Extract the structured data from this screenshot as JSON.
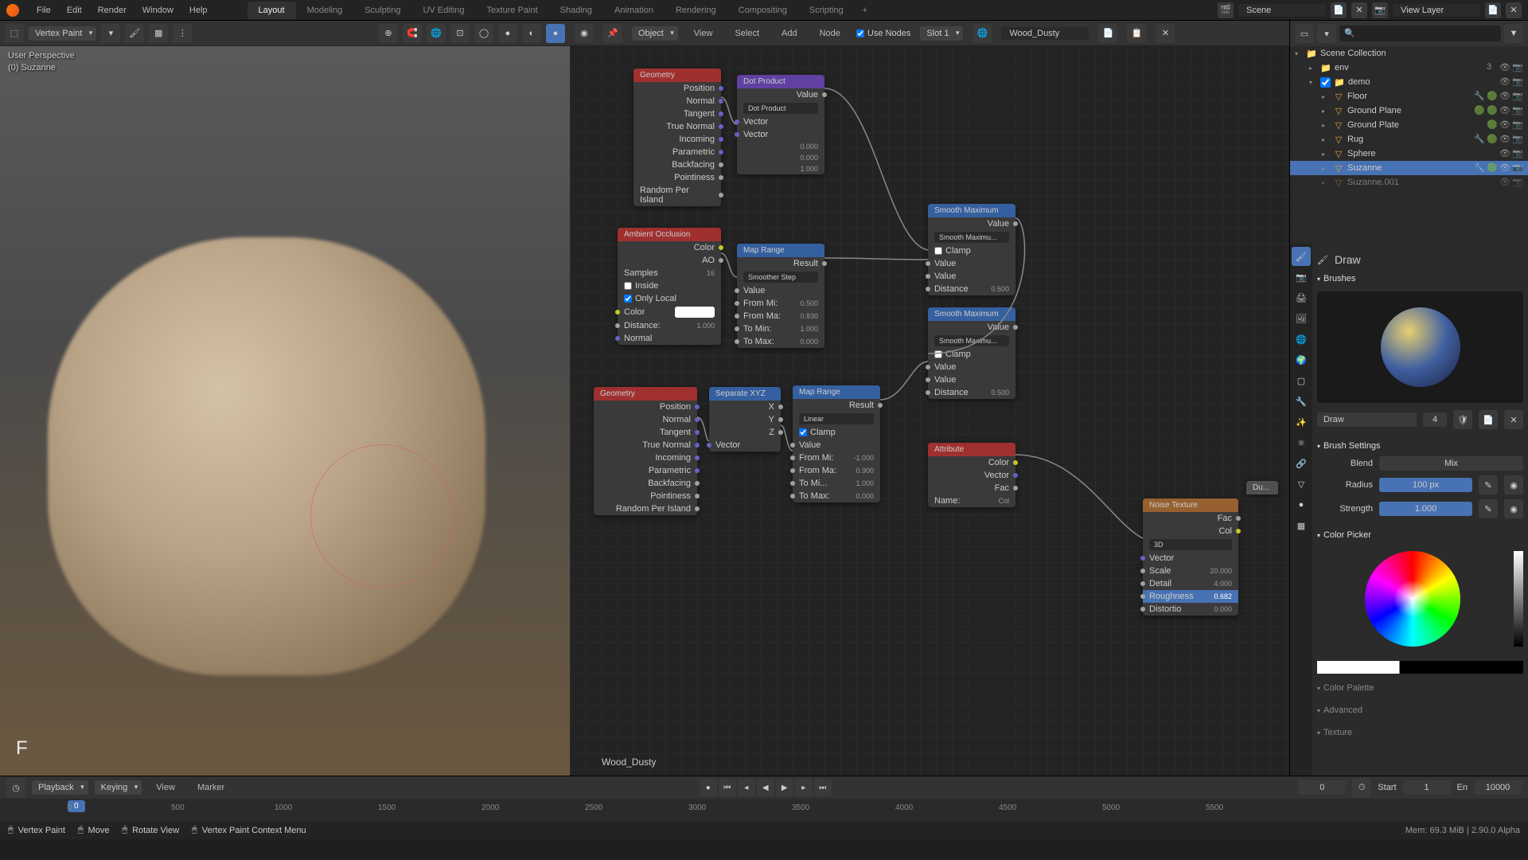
{
  "menu": {
    "file": "File",
    "edit": "Edit",
    "render": "Render",
    "window": "Window",
    "help": "Help"
  },
  "topRight": {
    "scene": "Scene",
    "viewLayer": "View Layer"
  },
  "workspaces": {
    "layout": "Layout",
    "modeling": "Modeling",
    "sculpting": "Sculpting",
    "uv": "UV Editing",
    "texpaint": "Texture Paint",
    "shading": "Shading",
    "animation": "Animation",
    "rendering": "Rendering",
    "compositing": "Compositing",
    "scripting": "Scripting",
    "add": "+"
  },
  "viewport": {
    "mode": "Vertex Paint",
    "perspective": "User Perspective",
    "object": "(0) Suzanne",
    "f": "F"
  },
  "nodeHeader": {
    "object": "Object",
    "view": "View",
    "select": "Select",
    "add": "Add",
    "node": "Node",
    "useNodes": "Use Nodes",
    "slot": "Slot 1",
    "material": "Wood_Dusty"
  },
  "nodes": {
    "geometry1": {
      "title": "Geometry",
      "position": "Position",
      "normal": "Normal",
      "tangent": "Tangent",
      "trueNormal": "True Normal",
      "incoming": "Incoming",
      "parametric": "Parametric",
      "backfacing": "Backfacing",
      "pointiness": "Pointiness",
      "randomPerIsland": "Random Per Island",
      "v1": "0.000",
      "v2": "0.000",
      "v3": "1.000"
    },
    "dotProduct": {
      "title": "Dot Product",
      "value": "Value",
      "mode": "Dot Product",
      "vector": "Vector",
      "vector2": "Vector"
    },
    "ao": {
      "title": "Ambient Occlusion",
      "color": "Color",
      "ao": "AO",
      "samples": "Samples",
      "samplesVal": "16",
      "inside": "Inside",
      "onlyLocal": "Only Local",
      "colorLabel": "Color",
      "distance": "Distance:",
      "distanceVal": "1.000",
      "normal": "Normal"
    },
    "mapRange1": {
      "title": "Map Range",
      "result": "Result",
      "interp": "Smoother Step",
      "value": "Value",
      "fromMin": "From Mi:",
      "fromMinVal": "0.500",
      "fromMax": "From Ma:",
      "fromMaxVal": "0.830",
      "toMin": "To Min:",
      "toMinVal": "1.000",
      "toMax": "To Max:",
      "toMaxVal": "0.000"
    },
    "geometry2": {
      "title": "Geometry",
      "position": "Position",
      "normal": "Normal",
      "tangent": "Tangent",
      "trueNormal": "True Normal",
      "incoming": "Incoming",
      "parametric": "Parametric",
      "backfacing": "Backfacing",
      "pointiness": "Pointiness",
      "randomPerIsland": "Random Per Island"
    },
    "sepXYZ": {
      "title": "Separate XYZ",
      "x": "X",
      "y": "Y",
      "z": "Z",
      "vector": "Vector"
    },
    "mapRange2": {
      "title": "Map Range",
      "result": "Result",
      "interp": "Linear",
      "clamp": "Clamp",
      "value": "Value",
      "fromMin": "From Mi:",
      "fromMinVal": "-1.000",
      "fromMax": "From Ma:",
      "fromMaxVal": "0.900",
      "toMin": "To Mi...",
      "toMinVal": "1.000",
      "toMax": "To Max:",
      "toMaxVal": "0.000"
    },
    "smoothMax1": {
      "title": "Smooth Maximum",
      "value": "Value",
      "mode": "Smooth Maximu...",
      "clamp": "Clamp",
      "valueIn": "Value",
      "valueIn2": "Value",
      "distance": "Distance",
      "distanceVal": "0.500"
    },
    "smoothMax2": {
      "title": "Smooth Maximum",
      "value": "Value",
      "mode": "Smooth Maximu...",
      "clamp": "Clamp",
      "valueIn": "Value",
      "valueIn2": "Value",
      "distance": "Distance",
      "distanceVal": "0.500"
    },
    "attribute": {
      "title": "Attribute",
      "color": "Color",
      "vector": "Vector",
      "fac": "Fac",
      "name": "Name:",
      "nameVal": "Col"
    },
    "noise": {
      "title": "Noise Texture",
      "fac": "Fac",
      "col": "Col",
      "mode": "3D",
      "vector": "Vector",
      "scale": "Scale",
      "scaleVal": "20.000",
      "detail": "Detail",
      "detailVal": "4.000",
      "roughness": "Roughness",
      "roughnessVal": "0.682",
      "distortion": "Distortio",
      "distortionVal": "0.000"
    },
    "dust": {
      "title": "Du..."
    }
  },
  "materialName": "Wood_Dusty",
  "outliner": {
    "sceneCollection": "Scene Collection",
    "env": "env",
    "envCount": "3",
    "demo": "demo",
    "floor": "Floor",
    "groundPlane": "Ground Plane",
    "groundPlate": "Ground Plate",
    "rug": "Rug",
    "sphere": "Sphere",
    "suzanne": "Suzanne",
    "suzanne001": "Suzanne.001"
  },
  "props": {
    "draw": "Draw",
    "brushes": "Brushes",
    "brushName": "Draw",
    "brushNum": "4",
    "brushSettings": "Brush Settings",
    "blend": "Blend",
    "blendMode": "Mix",
    "radius": "Radius",
    "radiusVal": "100 px",
    "strength": "Strength",
    "strengthVal": "1.000",
    "colorPicker": "Color Picker",
    "colorPalette": "Color Palette",
    "advanced": "Advanced",
    "texture": "Texture"
  },
  "timeline": {
    "playback": "Playback",
    "keying": "Keying",
    "view": "View",
    "marker": "Marker",
    "frame": "0",
    "start": "Start",
    "startVal": "1",
    "end": "En",
    "endVal": "10000",
    "ticks": [
      "0",
      "500",
      "1000",
      "1500",
      "2000",
      "2500",
      "3000",
      "3500",
      "4000",
      "4500",
      "5000",
      "5500"
    ]
  },
  "status": {
    "mode": "Vertex Paint",
    "move": "Move",
    "rotate": "Rotate View",
    "context": "Vertex Paint Context Menu",
    "mem": "Mem: 69.3 MiB | 2.90.0 Alpha"
  }
}
